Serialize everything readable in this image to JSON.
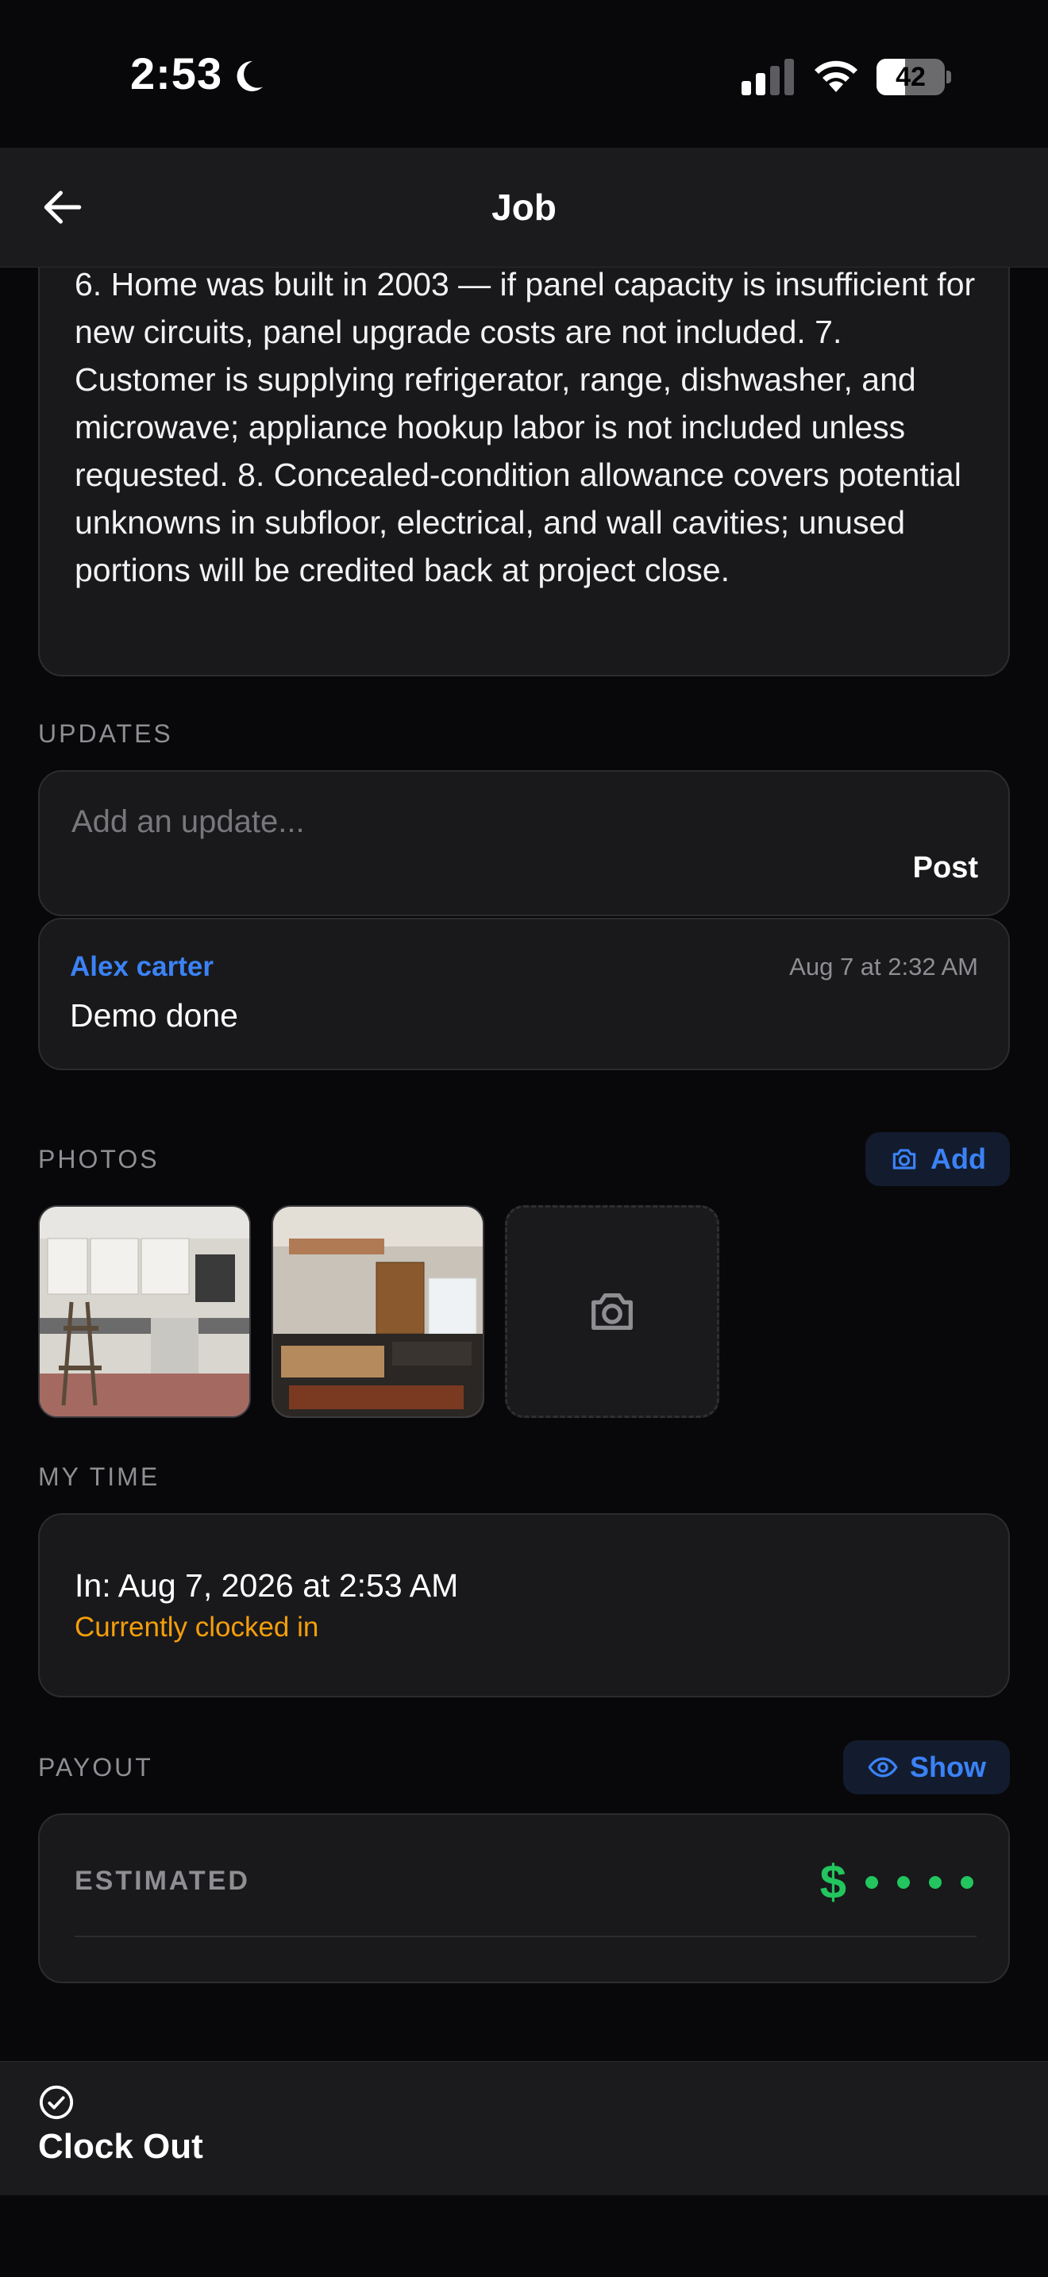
{
  "status_bar": {
    "time": "2:53",
    "battery": "42",
    "battery_level": 0.42,
    "moon_icon": "moon-icon",
    "signal_icon": "signal-icon",
    "wifi_icon": "wifi-icon"
  },
  "nav": {
    "back_icon": "arrow-left-icon",
    "title": "Job"
  },
  "notes": {
    "text": "6. Home was built in 2003 — if panel capacity is insufficient for new circuits, panel upgrade costs are not included. 7. Customer is supplying refrigerator, range, dishwasher, and microwave; appliance hookup labor is not included unless requested. 8. Concealed-condition allowance covers potential unknowns in subfloor, electrical, and wall cavities; unused portions will be credited back at project close."
  },
  "updates": {
    "label": "UPDATES",
    "placeholder": "Add an update...",
    "post_label": "Post",
    "items": [
      {
        "author": "Alex carter",
        "time": "Aug 7 at 2:32 AM",
        "body": "Demo done"
      }
    ]
  },
  "photos": {
    "label": "PHOTOS",
    "add_label": "Add",
    "add_icon": "camera-icon"
  },
  "my_time": {
    "label": "MY TIME",
    "clock_in": "In: Aug 7, 2026 at 2:53 AM",
    "status": "Currently clocked in"
  },
  "payout": {
    "label": "PAYOUT",
    "show_label": "Show",
    "show_icon": "eye-icon",
    "estimated_label": "ESTIMATED",
    "currency_symbol": "$"
  },
  "footer": {
    "clock_out_label": "Clock Out",
    "clock_out_icon": "check-circle-icon"
  },
  "colors": {
    "accent": "#3b82f6",
    "warning": "#f59e0b",
    "success": "#22c55e",
    "background": "#08080a",
    "card": "#19191b"
  }
}
